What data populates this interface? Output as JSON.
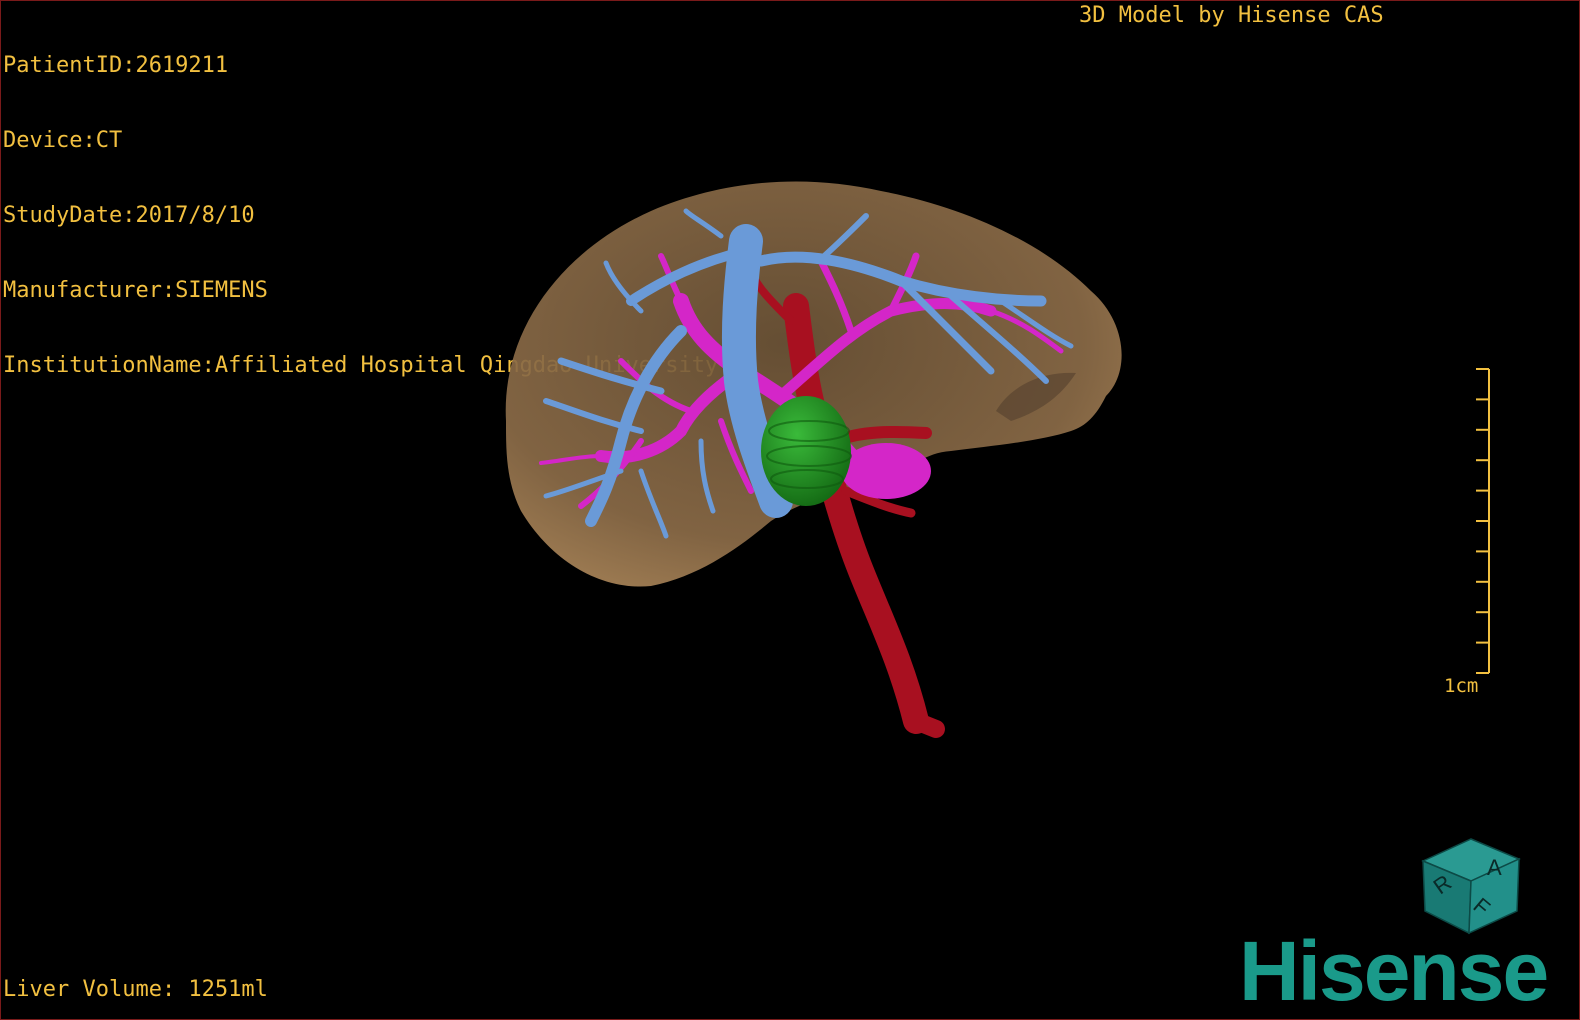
{
  "overlay": {
    "patient_id": "PatientID:2619211",
    "device": "Device:CT",
    "study_date": "StudyDate:2017/8/10",
    "manufacturer": "Manufacturer:SIEMENS",
    "institution": "InstitutionName:Affiliated Hospital Qingdao University-C",
    "credit": "3D Model by Hisense CAS",
    "liver_volume": "Liver Volume: 1251ml"
  },
  "scale": {
    "label": "1cm"
  },
  "orientation": {
    "face_top": "A",
    "face_left": "R",
    "face_front": "F"
  },
  "brand": {
    "logo": "Hisense"
  },
  "colors": {
    "overlay_text": "#f2c040",
    "liver": "#9a7750",
    "hepatic_vein": "#6a9ad8",
    "portal_vein": "#d426c8",
    "artery": "#a81020",
    "tumor": "#1e8a1e",
    "brand": "#1a9a8a"
  }
}
